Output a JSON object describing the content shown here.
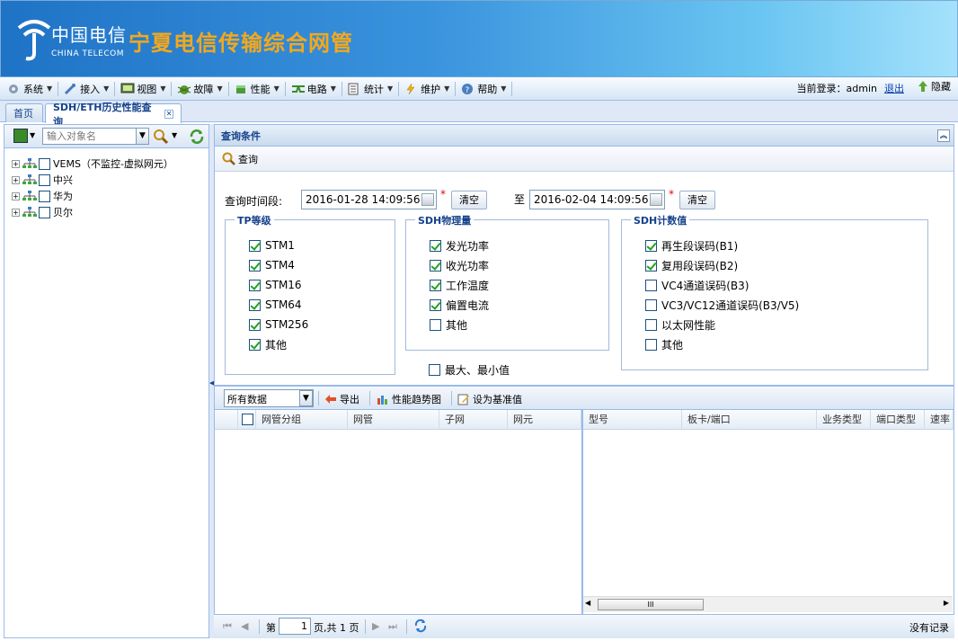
{
  "brand": {
    "cn": "中国电信",
    "en": "CHINA TELECOM",
    "title": "宁夏电信传输综合网管"
  },
  "menu": [
    {
      "label": "系统",
      "icon": "gear-icon"
    },
    {
      "label": "接入",
      "icon": "wrench-icon"
    },
    {
      "label": "视图",
      "icon": "monitor-icon"
    },
    {
      "label": "故障",
      "icon": "bug-icon"
    },
    {
      "label": "性能",
      "icon": "cube-icon"
    },
    {
      "label": "电路",
      "icon": "circuit-icon"
    },
    {
      "label": "统计",
      "icon": "document-icon"
    },
    {
      "label": "维护",
      "icon": "lightning-icon"
    },
    {
      "label": "帮助",
      "icon": "help-icon"
    }
  ],
  "user": {
    "login_label": "当前登录：admin",
    "logout": "退出",
    "hide": "隐藏"
  },
  "tabs": [
    {
      "label": "首页"
    },
    {
      "label": "SDH/ETH历史性能查询"
    }
  ],
  "left": {
    "search_placeholder": "输入对象名",
    "tree": [
      {
        "label": "VEMS（不监控-虚拟网元）"
      },
      {
        "label": "中兴"
      },
      {
        "label": "华为"
      },
      {
        "label": "贝尔"
      }
    ]
  },
  "query": {
    "header": "查询条件",
    "search_button": "查询",
    "time_label": "查询时间段:",
    "start": "2016-01-28 14:09:56",
    "end": "2016-02-04 14:09:56",
    "to": "至",
    "clear": "清空",
    "required": "*",
    "tp": {
      "legend": "TP等级",
      "items": [
        {
          "label": "STM1",
          "checked": true
        },
        {
          "label": "STM4",
          "checked": true
        },
        {
          "label": "STM16",
          "checked": true
        },
        {
          "label": "STM64",
          "checked": true
        },
        {
          "label": "STM256",
          "checked": true
        },
        {
          "label": "其他",
          "checked": true
        }
      ]
    },
    "phys": {
      "legend": "SDH物理量",
      "items": [
        {
          "label": "发光功率",
          "checked": true
        },
        {
          "label": "收光功率",
          "checked": true
        },
        {
          "label": "工作温度",
          "checked": true
        },
        {
          "label": "偏置电流",
          "checked": true
        },
        {
          "label": "其他",
          "checked": false
        }
      ]
    },
    "count": {
      "legend": "SDH计数值",
      "items": [
        {
          "label": "再生段误码(B1)",
          "checked": true
        },
        {
          "label": "复用段误码(B2)",
          "checked": true
        },
        {
          "label": "VC4通道误码(B3)",
          "checked": false
        },
        {
          "label": "VC3/VC12通道误码(B3/V5)",
          "checked": false
        },
        {
          "label": "以太网性能",
          "checked": false
        },
        {
          "label": "其他",
          "checked": false
        }
      ]
    },
    "minmax": {
      "label": "最大、最小值",
      "checked": false
    }
  },
  "grid": {
    "filter": "所有数据",
    "export": "导出",
    "trend": "性能趋势图",
    "baseline": "设为基准值",
    "left_cols": [
      "网管分组",
      "网管",
      "子网",
      "网元"
    ],
    "right_cols": [
      "型号",
      "板卡/端口",
      "业务类型",
      "端口类型",
      "速率"
    ],
    "scroll_thumb": "III"
  },
  "pager": {
    "page_prefix": "第",
    "page": "1",
    "page_suffix": "页,共 1 页",
    "status": "没有记录"
  },
  "colors": {
    "accent": "#15428b",
    "banner_start": "#1f73c6",
    "banner_end": "#a4e1fb",
    "title": "#f3a81c",
    "border": "#99bbe8"
  }
}
